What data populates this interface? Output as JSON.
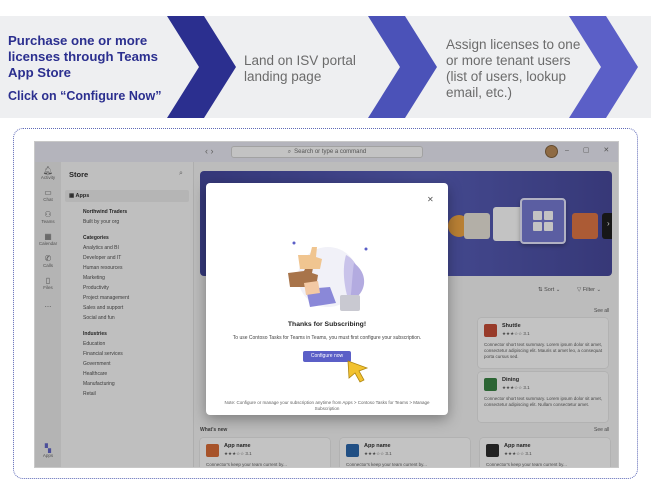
{
  "flow": {
    "step1_text": "Purchase one or more licenses through Teams App Store",
    "step1_cta": "Click on “Configure Now”",
    "step2_text": "Land on ISV portal landing page",
    "step3_text": "Assign licenses to one or more tenant users (list of users, lookup email, etc.)",
    "colors": {
      "dark": "#2b2f8f",
      "mid": "#5b5fc7",
      "band": "#eeeff1"
    }
  },
  "teams": {
    "search_placeholder": "Search or type a command",
    "rail": [
      "Activity",
      "Chat",
      "Teams",
      "Calendar",
      "Calls",
      "Files",
      "...",
      "Apps"
    ],
    "store": {
      "title": "Store",
      "apps_label": "Apps",
      "org_header": "Northwind Traders",
      "org_item": "Built by your org",
      "categories_header": "Categories",
      "categories": [
        "Analytics and BI",
        "Developer and IT",
        "Human resources",
        "Marketing",
        "Productivity",
        "Project management",
        "Sales and support",
        "Social and fun"
      ],
      "industries_header": "Industries",
      "industries": [
        "Education",
        "Financial services",
        "Government",
        "Healthcare",
        "Manufacturing",
        "Retail"
      ]
    },
    "main": {
      "sort_label": "Sort",
      "filter_label": "Filter",
      "see_all": "See all",
      "whats_new": "What's new",
      "cards_top": [
        {
          "name": "Shuttle",
          "rating": "★★★☆☆ 3.1",
          "desc": "Connector short text summary. Lorem ipsum dolor sit amet, consectetur adipiscing elit. Mauris ut amet leo, a consequat porta cursus sed.",
          "color": "#c4432b"
        },
        {
          "name": "Dining",
          "rating": "★★★☆☆ 3.1",
          "desc": "Connector short text summary. Lorem ipsum dolor sit amet, consectetur adipiscing elit. Nullam consectetur amet.",
          "color": "#2f7d3a"
        }
      ],
      "cards_new": [
        {
          "name": "App name",
          "rating": "★★★☆☆ 3.1",
          "desc": "Connector's keep your team current by...",
          "color": "#d9642b"
        },
        {
          "name": "App name",
          "rating": "★★★☆☆ 3.1",
          "desc": "Connector's keep your team current by...",
          "color": "#1f5fa8"
        },
        {
          "name": "App name",
          "rating": "★★★☆☆ 3.1",
          "desc": "Connector's keep your team current by...",
          "color": "#202020"
        }
      ]
    },
    "modal": {
      "title": "Thanks for Subscribing!",
      "message": "To use Contoso Tasks for Teams in Teams, you must first configure your subscription.",
      "button": "Configure now",
      "note": "Note: Configure or manage your subscription anytime from Apps > Contoso Tasks for Teams > Manage Subscription"
    }
  }
}
